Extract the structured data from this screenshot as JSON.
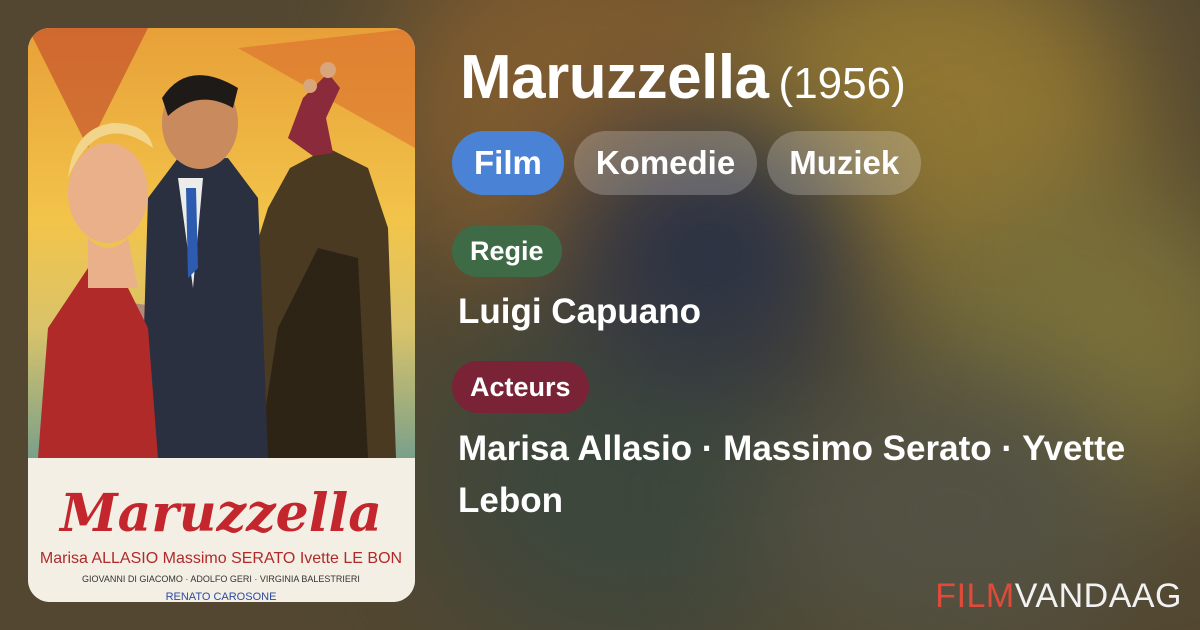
{
  "movie": {
    "title": "Maruzzella",
    "year": "(1956)"
  },
  "genres": [
    {
      "label": "Film",
      "active": true
    },
    {
      "label": "Komedie",
      "active": false
    },
    {
      "label": "Muziek",
      "active": false
    }
  ],
  "director": {
    "label": "Regie",
    "name": "Luigi Capuano"
  },
  "actors": {
    "label": "Acteurs",
    "names": "Marisa Allasio · Massimo Serato · Yvette Lebon"
  },
  "poster": {
    "title_text": "Maruzzella",
    "credits_line1": "Marisa ALLASIO Massimo SERATO Ivette LE BON",
    "credits_line2": "GIOVANNI DI GIACOMO · ADOLFO GERI · VIRGINIA BALESTRIERI",
    "credits_line3": "RENATO CAROSONE"
  },
  "brand": {
    "part1": "FILM",
    "part2": "VANDAAG",
    "color_part1": "#e04a3a"
  },
  "colors": {
    "genre_active": "#4a82d6",
    "director_chip": "#3e6a46",
    "actors_chip": "#7a2236"
  }
}
